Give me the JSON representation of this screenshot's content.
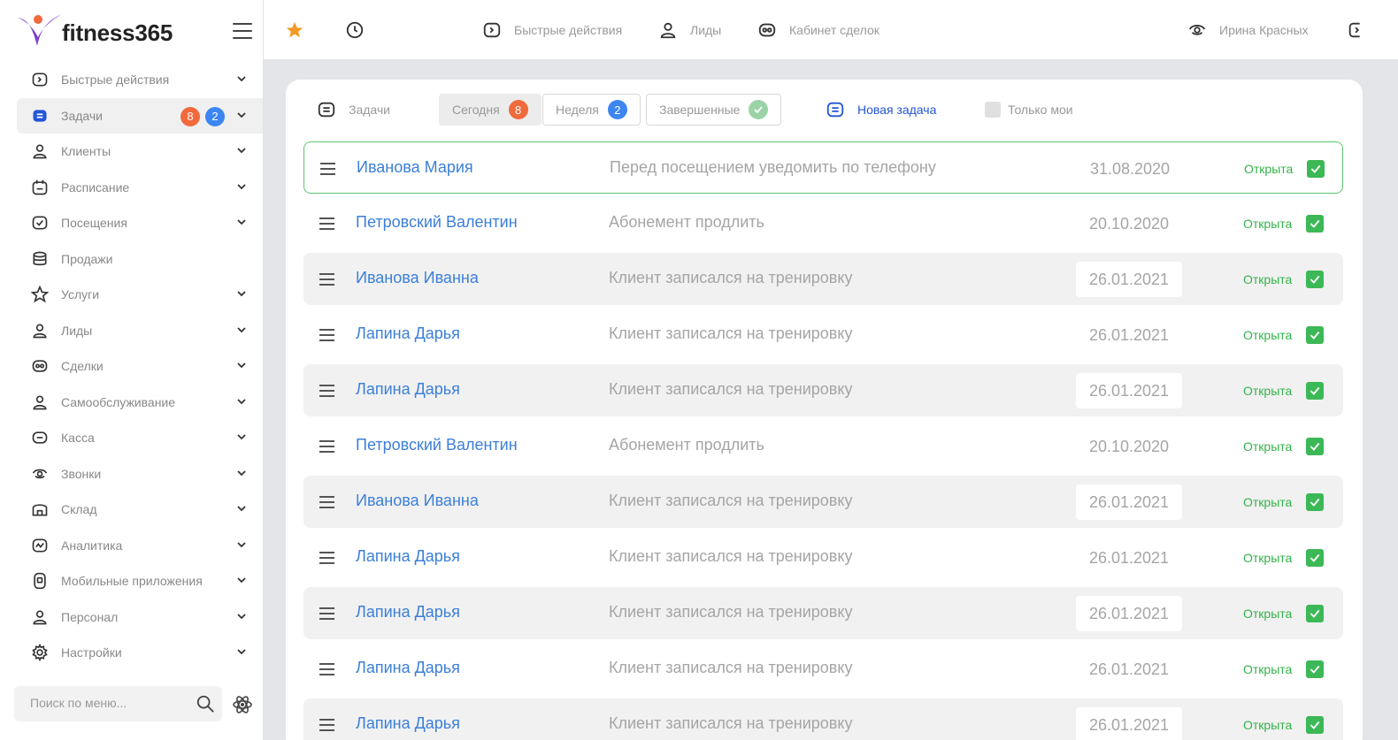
{
  "app": {
    "logo_text": "fitness365"
  },
  "sidebar": {
    "items": [
      {
        "label": "Быстрые действия",
        "icon": "quick-actions-icon",
        "chevron": true
      },
      {
        "label": "Задачи",
        "icon": "tasks-icon",
        "chevron": true,
        "active": true,
        "badges": [
          "8",
          "2"
        ]
      },
      {
        "label": "Клиенты",
        "icon": "person-icon",
        "chevron": true
      },
      {
        "label": "Расписание",
        "icon": "calendar-icon",
        "chevron": true
      },
      {
        "label": "Посещения",
        "icon": "check-calendar-icon",
        "chevron": true
      },
      {
        "label": "Продажи",
        "icon": "coins-icon",
        "chevron": false
      },
      {
        "label": "Услуги",
        "icon": "star-icon",
        "chevron": true
      },
      {
        "label": "Лиды",
        "icon": "person-icon",
        "chevron": true
      },
      {
        "label": "Сделки",
        "icon": "deals-icon",
        "chevron": true
      },
      {
        "label": "Самообслуживание",
        "icon": "person-icon",
        "chevron": true
      },
      {
        "label": "Касса",
        "icon": "cashbox-icon",
        "chevron": true
      },
      {
        "label": "Звонки",
        "icon": "calls-icon",
        "chevron": true
      },
      {
        "label": "Склад",
        "icon": "warehouse-icon",
        "chevron": true
      },
      {
        "label": "Аналитика",
        "icon": "analytics-icon",
        "chevron": true
      },
      {
        "label": "Мобильные приложения",
        "icon": "mobile-icon",
        "chevron": true
      },
      {
        "label": "Персонал",
        "icon": "person-icon",
        "chevron": true
      },
      {
        "label": "Настройки",
        "icon": "gear-icon",
        "chevron": true
      }
    ],
    "search_placeholder": "Поиск по меню..."
  },
  "topbar": {
    "quick_actions": "Быстрые действия",
    "leads": "Лиды",
    "deals_cabinet": "Кабинет сделок",
    "user_name": "Ирина Красных"
  },
  "filters": {
    "tasks_label": "Задачи",
    "today_label": "Сегодня",
    "today_count": "8",
    "week_label": "Неделя",
    "week_count": "2",
    "done_label": "Завершенные",
    "new_task_label": "Новая задача",
    "only_mine_label": "Только мои"
  },
  "colors": {
    "accent_blue": "#3b7fd9",
    "status_green": "#34b24a",
    "badge_orange": "#f06a3c",
    "badge_blue": "#3d86f2"
  },
  "tasks": [
    {
      "name": "Иванова Мария",
      "desc": "Перед посещением уведомить по телефону",
      "date": "31.08.2020",
      "status": "Открыта"
    },
    {
      "name": "Петровский Валентин",
      "desc": "Абонемент продлить",
      "date": "20.10.2020",
      "status": "Открыта"
    },
    {
      "name": "Иванова Иванна",
      "desc": "Клиент записался на тренировку",
      "date": "26.01.2021",
      "status": "Открыта"
    },
    {
      "name": "Лапина Дарья",
      "desc": "Клиент записался на тренировку",
      "date": "26.01.2021",
      "status": "Открыта"
    },
    {
      "name": "Лапина Дарья",
      "desc": "Клиент записался на тренировку",
      "date": "26.01.2021",
      "status": "Открыта"
    },
    {
      "name": "Петровский Валентин",
      "desc": "Абонемент продлить",
      "date": "20.10.2020",
      "status": "Открыта"
    },
    {
      "name": "Иванова Иванна",
      "desc": "Клиент записался на тренировку",
      "date": "26.01.2021",
      "status": "Открыта"
    },
    {
      "name": "Лапина Дарья",
      "desc": "Клиент записался на тренировку",
      "date": "26.01.2021",
      "status": "Открыта"
    },
    {
      "name": "Лапина Дарья",
      "desc": "Клиент записался на тренировку",
      "date": "26.01.2021",
      "status": "Открыта"
    },
    {
      "name": "Лапина Дарья",
      "desc": "Клиент записался на тренировку",
      "date": "26.01.2021",
      "status": "Открыта"
    },
    {
      "name": "Лапина Дарья",
      "desc": "Клиент записался на тренировку",
      "date": "26.01.2021",
      "status": "Открыта"
    }
  ]
}
